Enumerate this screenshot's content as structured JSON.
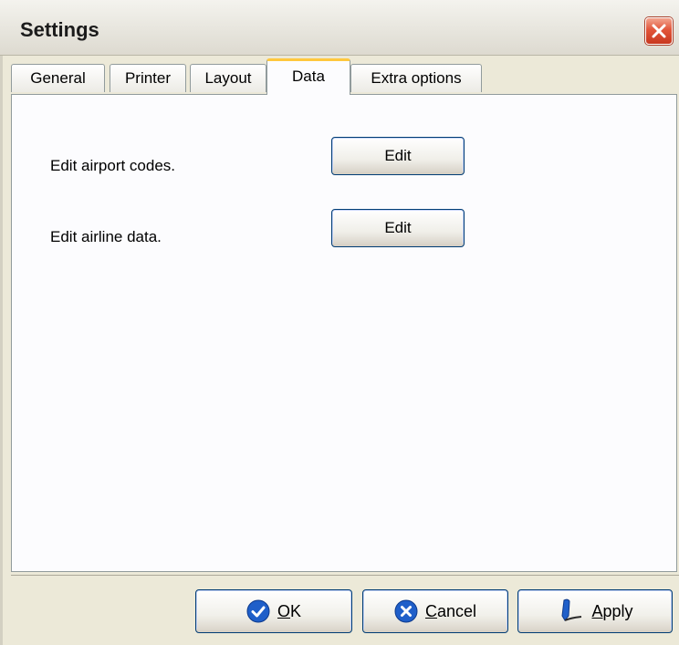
{
  "window": {
    "title": "Settings"
  },
  "tabs": [
    {
      "label": "General",
      "active": false
    },
    {
      "label": "Printer",
      "active": false
    },
    {
      "label": "Layout",
      "active": false
    },
    {
      "label": "Data",
      "active": true
    },
    {
      "label": "Extra options",
      "active": false
    }
  ],
  "data_tab": {
    "airport_label": "Edit airport codes.",
    "airport_button": "Edit",
    "airline_label": "Edit airline data.",
    "airline_button": "Edit"
  },
  "footer": {
    "ok": {
      "mnemonic": "O",
      "rest": "K",
      "icon": "check-circle-icon"
    },
    "cancel": {
      "mnemonic": "C",
      "rest": "ancel",
      "icon": "x-circle-icon"
    },
    "apply": {
      "mnemonic": "A",
      "rest": "pply",
      "icon": "pen-icon"
    }
  },
  "colors": {
    "active_tab_accent": "#ffc83d",
    "button_border": "#003c74",
    "close_button": "#e2553a",
    "icon_blue": "#1f5fc9"
  }
}
